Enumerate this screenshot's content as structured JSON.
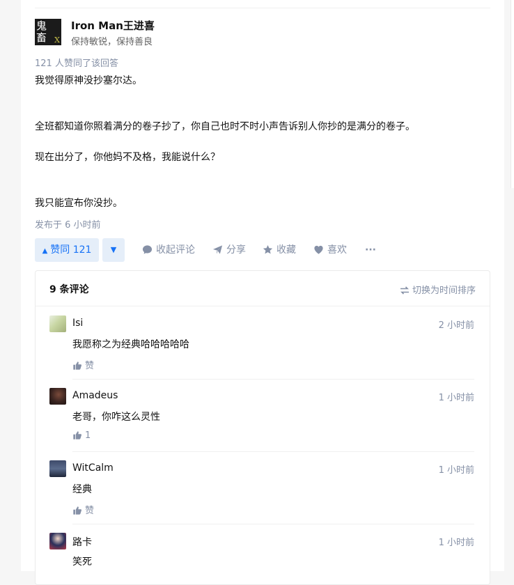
{
  "author": {
    "name": "Iron Man王进喜",
    "bio": "保持敏锐，保持善良",
    "avatar_text": "鬼畜",
    "avatar_mark": "X"
  },
  "answer": {
    "votes_text": "121 人赞同了该回答",
    "paragraphs": [
      "我觉得原神没抄塞尔达。",
      "全班都知道你照着满分的卷子抄了，你自己也时不时小声告诉别人你抄的是满分的卷子。",
      "现在出分了，你他妈不及格，我能说什么？",
      "我只能宣布你没抄。"
    ],
    "published": "发布于 6 小时前"
  },
  "actions": {
    "vote_up_label": "赞同 121",
    "comment_label": "收起评论",
    "share_label": "分享",
    "favorite_label": "收藏",
    "like_label": "喜欢",
    "more_label": "···"
  },
  "comments": {
    "count_label": "9 条评论",
    "sort_label": "切换为时间排序",
    "items": [
      {
        "name": "Isi",
        "time": "2 小时前",
        "text": "我愿称之为经典哈哈哈哈哈",
        "like": "赞"
      },
      {
        "name": "Amadeus",
        "time": "1 小时前",
        "text": "老哥，你咋这么灵性",
        "like": "1"
      },
      {
        "name": "WitCalm",
        "time": "1 小时前",
        "text": "经典",
        "like": "赞"
      },
      {
        "name": "路卡",
        "time": "1 小时前",
        "text": "笑死",
        "like": ""
      }
    ]
  },
  "colors": {
    "accent": "#1772f6",
    "accent_bg": "#e5eef9",
    "muted": "#8590a6"
  }
}
